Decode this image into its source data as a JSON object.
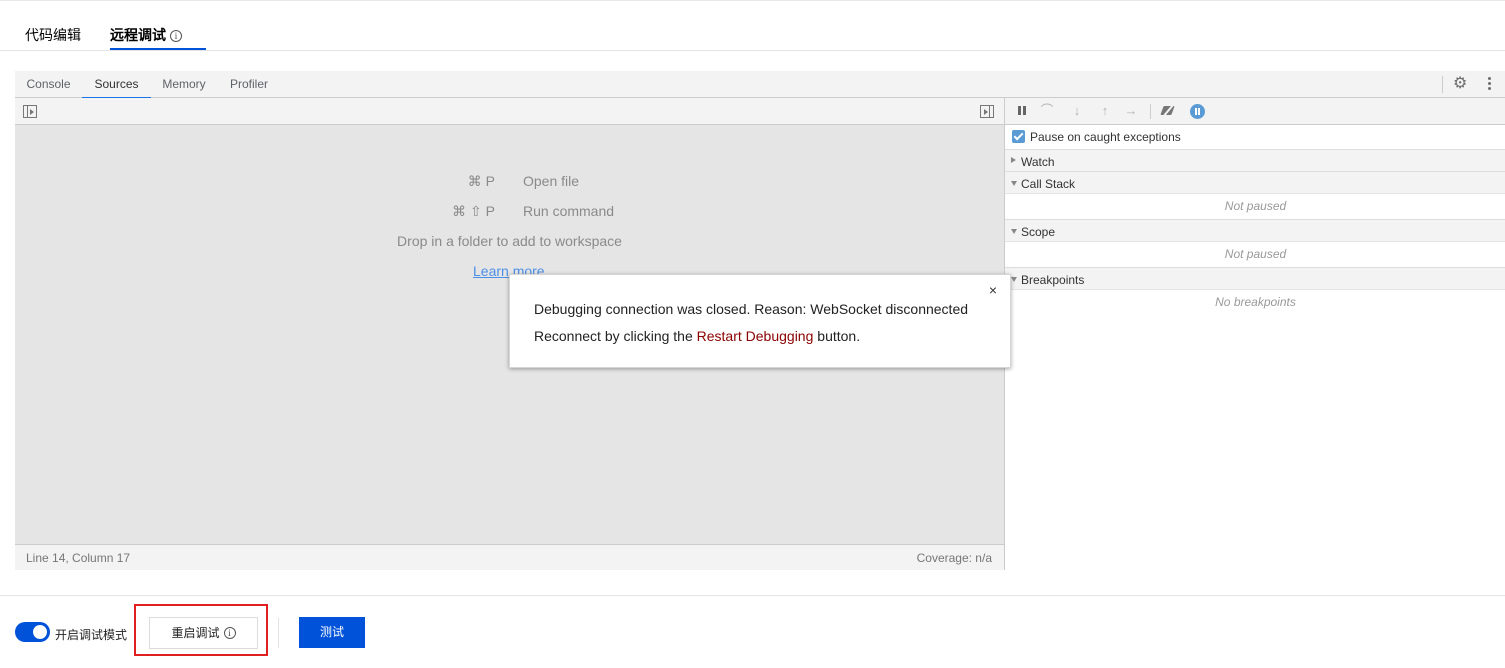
{
  "top_tabs": {
    "code_edit": "代码编辑",
    "remote_debug": "远程调试",
    "info_glyph": "i"
  },
  "devtools": {
    "tabs": [
      "Console",
      "Sources",
      "Memory",
      "Profiler"
    ],
    "active_tab": "Sources",
    "settings_icon": "⚙"
  },
  "editor": {
    "shortcuts": [
      {
        "keys": "⌘ P",
        "label": "Open file"
      },
      {
        "keys": "⌘ ⇧ P",
        "label": "Run command"
      }
    ],
    "drop_text": "Drop in a folder to add to workspace",
    "learn_more": "Learn more",
    "status_position": "Line 14, Column 17",
    "status_coverage": "Coverage: n/a"
  },
  "debugger": {
    "step_over_glyph": "⌒",
    "step_into_glyph": "↓",
    "step_out_glyph": "↑",
    "step_glyph": "→",
    "pause_caught": "Pause on caught exceptions",
    "sections": {
      "watch": "Watch",
      "call_stack": "Call Stack",
      "call_stack_body": "Not paused",
      "scope": "Scope",
      "scope_body": "Not paused",
      "breakpoints": "Breakpoints",
      "breakpoints_body": "No breakpoints"
    }
  },
  "dialog": {
    "close": "×",
    "line1": "Debugging connection was closed. Reason: WebSocket disconnected",
    "line2_prefix": "Reconnect by clicking the ",
    "line2_link": "Restart Debugging",
    "line2_suffix": " button."
  },
  "bottom": {
    "debug_mode_label": "开启调试模式",
    "debug_mode_on": true,
    "restart_label": "重启调试",
    "test_label": "测试"
  },
  "colors": {
    "brand": "#0052d9",
    "highlight": "#e02020",
    "dialog_link": "#8b0000"
  }
}
